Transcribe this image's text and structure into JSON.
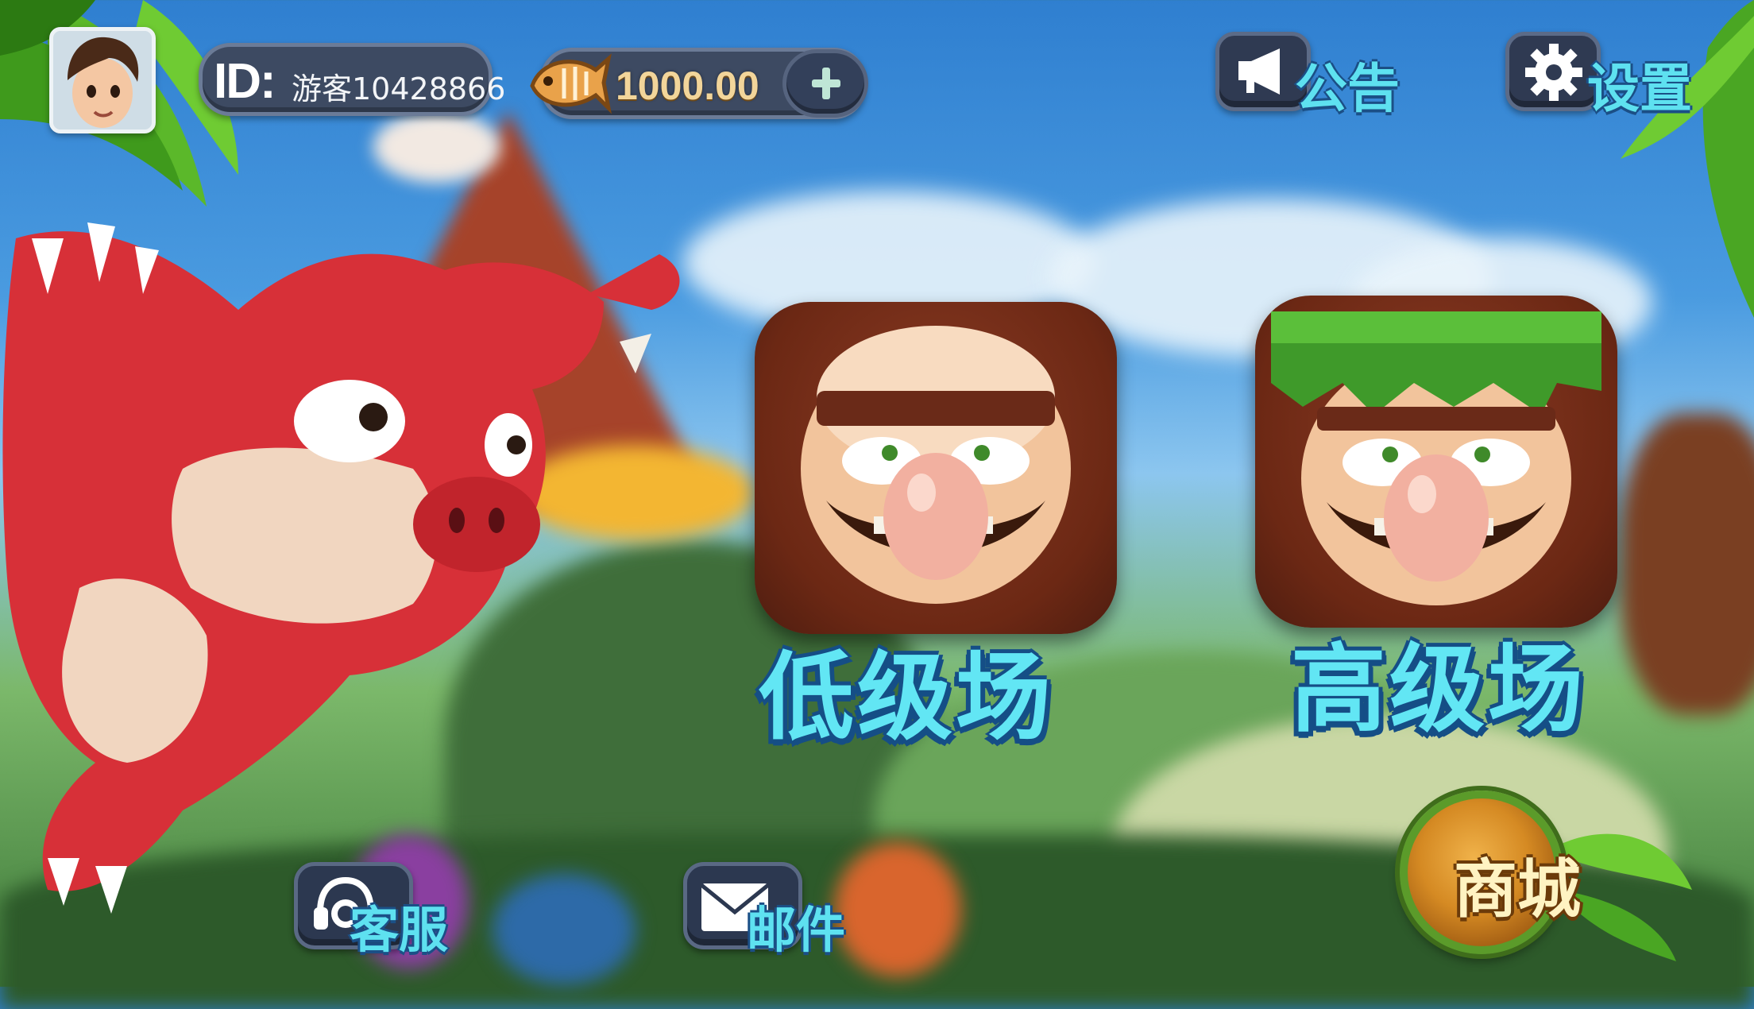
{
  "player": {
    "id_tag": "ID:",
    "id_value": "游客10428866",
    "balance": "1000.00"
  },
  "top_menu": {
    "notice_label": "公告",
    "settings_label": "设置"
  },
  "rooms": {
    "low_label": "低级场",
    "high_label": "高级场"
  },
  "bottom_menu": {
    "service_label": "客服",
    "mail_label": "邮件",
    "shop_label": "商城"
  },
  "icons": {
    "avatar": "player-avatar",
    "coin": "fish-coin-icon",
    "plus": "plus-icon",
    "notice": "megaphone-icon",
    "settings": "gear-icon",
    "service": "headset-icon",
    "mail": "envelope-icon"
  },
  "colors": {
    "label_cyan": "#5ee1f0",
    "label_outline": "#1b4f86",
    "pill_bg": "#3d4a62",
    "shop_gold": "#d58a23"
  }
}
